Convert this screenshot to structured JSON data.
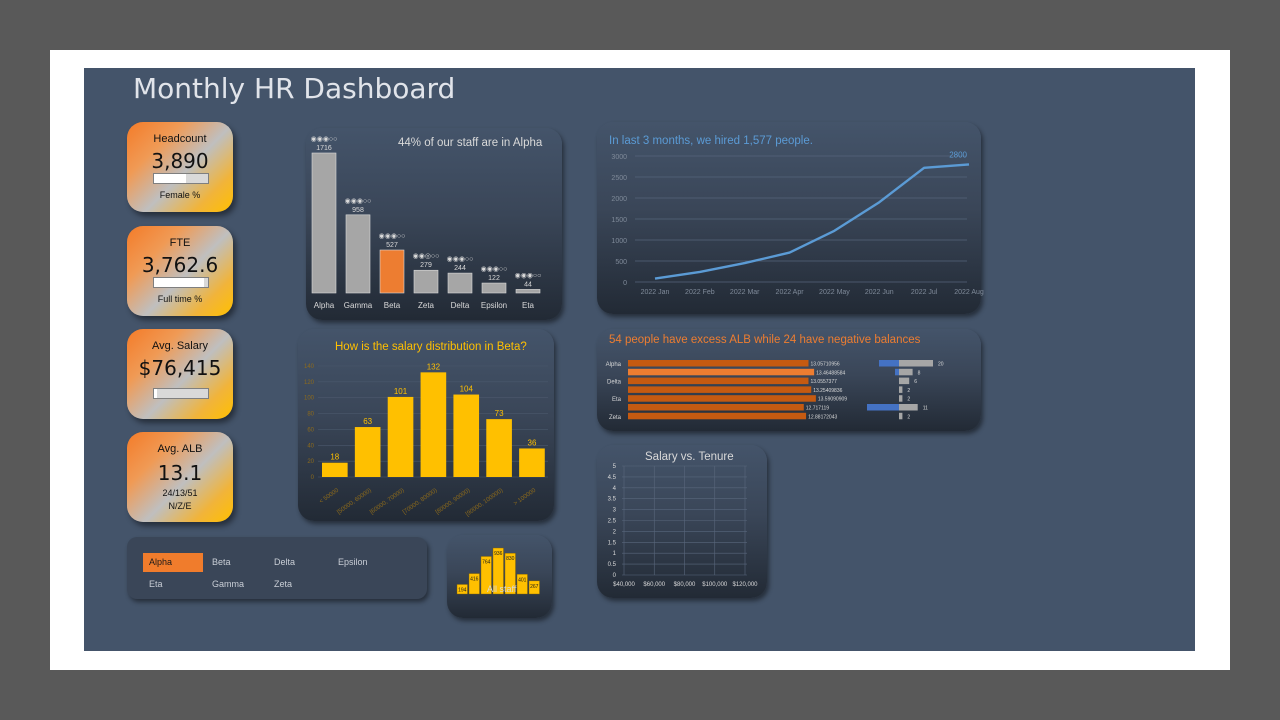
{
  "title": "Monthly HR Dashboard",
  "kpis": {
    "headcount": {
      "label": "Headcount",
      "value": "3,890",
      "sub": "Female %",
      "bar_fraction": 0.6
    },
    "fte": {
      "label": "FTE",
      "value": "3,762.6",
      "sub": "Full time %",
      "bar_fraction": 0.92
    },
    "salary": {
      "label": "Avg. Salary",
      "value": "$76,415",
      "bar_fraction": 0.05
    },
    "alb": {
      "label": "Avg. ALB",
      "value": "13.1",
      "sub1": "24/13/51",
      "sub2": "N/Z/E"
    }
  },
  "staff_chart": {
    "title": "44% of our staff are in Alpha",
    "rating_icon": "◉◉◉○○",
    "rating_icon_b": "◉◉◎○○",
    "colors": {
      "bar": "#a6a6a6",
      "highlight": "#ed7d31"
    },
    "chart_data": {
      "type": "bar",
      "categories": [
        "Alpha",
        "Gamma",
        "Beta",
        "Zeta",
        "Delta",
        "Epsilon",
        "Eta"
      ],
      "values": [
        1716,
        958,
        527,
        279,
        244,
        122,
        44
      ],
      "highlight": "Beta"
    }
  },
  "hires_chart": {
    "title": "In last 3 months, we hired 1,577 people.",
    "last_label": "2800",
    "color": "#5b9bd5",
    "chart_data": {
      "type": "line",
      "x": [
        "2022 Jan",
        "2022 Feb",
        "2022 Mar",
        "2022 Apr",
        "2022 May",
        "2022 Jun",
        "2022 Jul",
        "2022 Aug"
      ],
      "y": [
        80,
        240,
        450,
        700,
        1220,
        1900,
        2720,
        2800
      ],
      "ylim": [
        0,
        3000
      ],
      "yticks": [
        "0",
        "500",
        "1000",
        "1500",
        "2000",
        "2500",
        "3000"
      ]
    }
  },
  "salary_dist": {
    "title": "How is the salary distribution in Beta?",
    "color": "#ffc000",
    "chart_data": {
      "type": "bar",
      "categories": [
        "< 50000",
        "[50000, 60000)",
        "[60000, 70000)",
        "[70000, 80000)",
        "[80000, 90000)",
        "[90000, 100000)",
        "> 100000"
      ],
      "values": [
        18,
        63,
        101,
        132,
        104,
        73,
        36
      ],
      "ylim": [
        0,
        140
      ],
      "yticks": [
        "0",
        "20",
        "40",
        "60",
        "80",
        "100",
        "120",
        "140"
      ]
    }
  },
  "alb_chart": {
    "title": "54 people have excess ALB while 24 have negative balances",
    "colors": {
      "bar": "#c55a11",
      "highlight": "#ed7d31",
      "grey": "#a6a6a6",
      "blue": "#4472c4"
    },
    "chart_data": {
      "type": "bar",
      "rows": [
        {
          "label": "Alpha",
          "value": 13.05710956,
          "value_text": "13.05710956",
          "neg": 5,
          "excess": 20,
          "excess_text": "20"
        },
        {
          "label": "",
          "value": 13.46488584,
          "value_text": "13.46488584",
          "neg": 1,
          "excess": 8,
          "excess_text": "8",
          "highlight": true
        },
        {
          "label": "Delta",
          "value": 13.0557377,
          "value_text": "13.0557377",
          "neg": 0,
          "excess": 6,
          "excess_text": "6"
        },
        {
          "label": "",
          "value": 13.25409836,
          "value_text": "13.25409836",
          "neg": 0,
          "excess": 2,
          "excess_text": "2"
        },
        {
          "label": "Eta",
          "value": 13.59090909,
          "value_text": "13.59090909",
          "neg": 0,
          "excess": 2,
          "excess_text": "2"
        },
        {
          "label": "",
          "value": 12.717119,
          "value_text": "12.717119",
          "neg": 8,
          "excess": 11,
          "excess_text": "11"
        },
        {
          "label": "Zeta",
          "value": 12.88172043,
          "value_text": "12.88172043",
          "neg": 0,
          "excess": 2,
          "excess_text": "2"
        }
      ]
    }
  },
  "scatter": {
    "title": "Salary vs. Tenure",
    "chart_data": {
      "type": "scatter",
      "points": [],
      "xticks": [
        "$40,000",
        "$60,000",
        "$80,000",
        "$100,000",
        "$120,000"
      ],
      "yticks": [
        "0",
        "0.5",
        "1",
        "1.5",
        "2",
        "2.5",
        "3",
        "3.5",
        "4",
        "4.5",
        "5"
      ],
      "xlim": [
        40000,
        120000
      ],
      "ylim": [
        0,
        5
      ]
    }
  },
  "slicer": {
    "items": [
      "Alpha",
      "Beta",
      "Delta",
      "Epsilon",
      "Eta",
      "Gamma",
      "Zeta"
    ],
    "selected": "Alpha"
  },
  "all_staff": {
    "label": "All staff",
    "color": "#ffc000",
    "chart_data": {
      "type": "bar",
      "values": [
        194,
        416,
        764,
        936,
        830,
        401,
        267
      ]
    }
  }
}
